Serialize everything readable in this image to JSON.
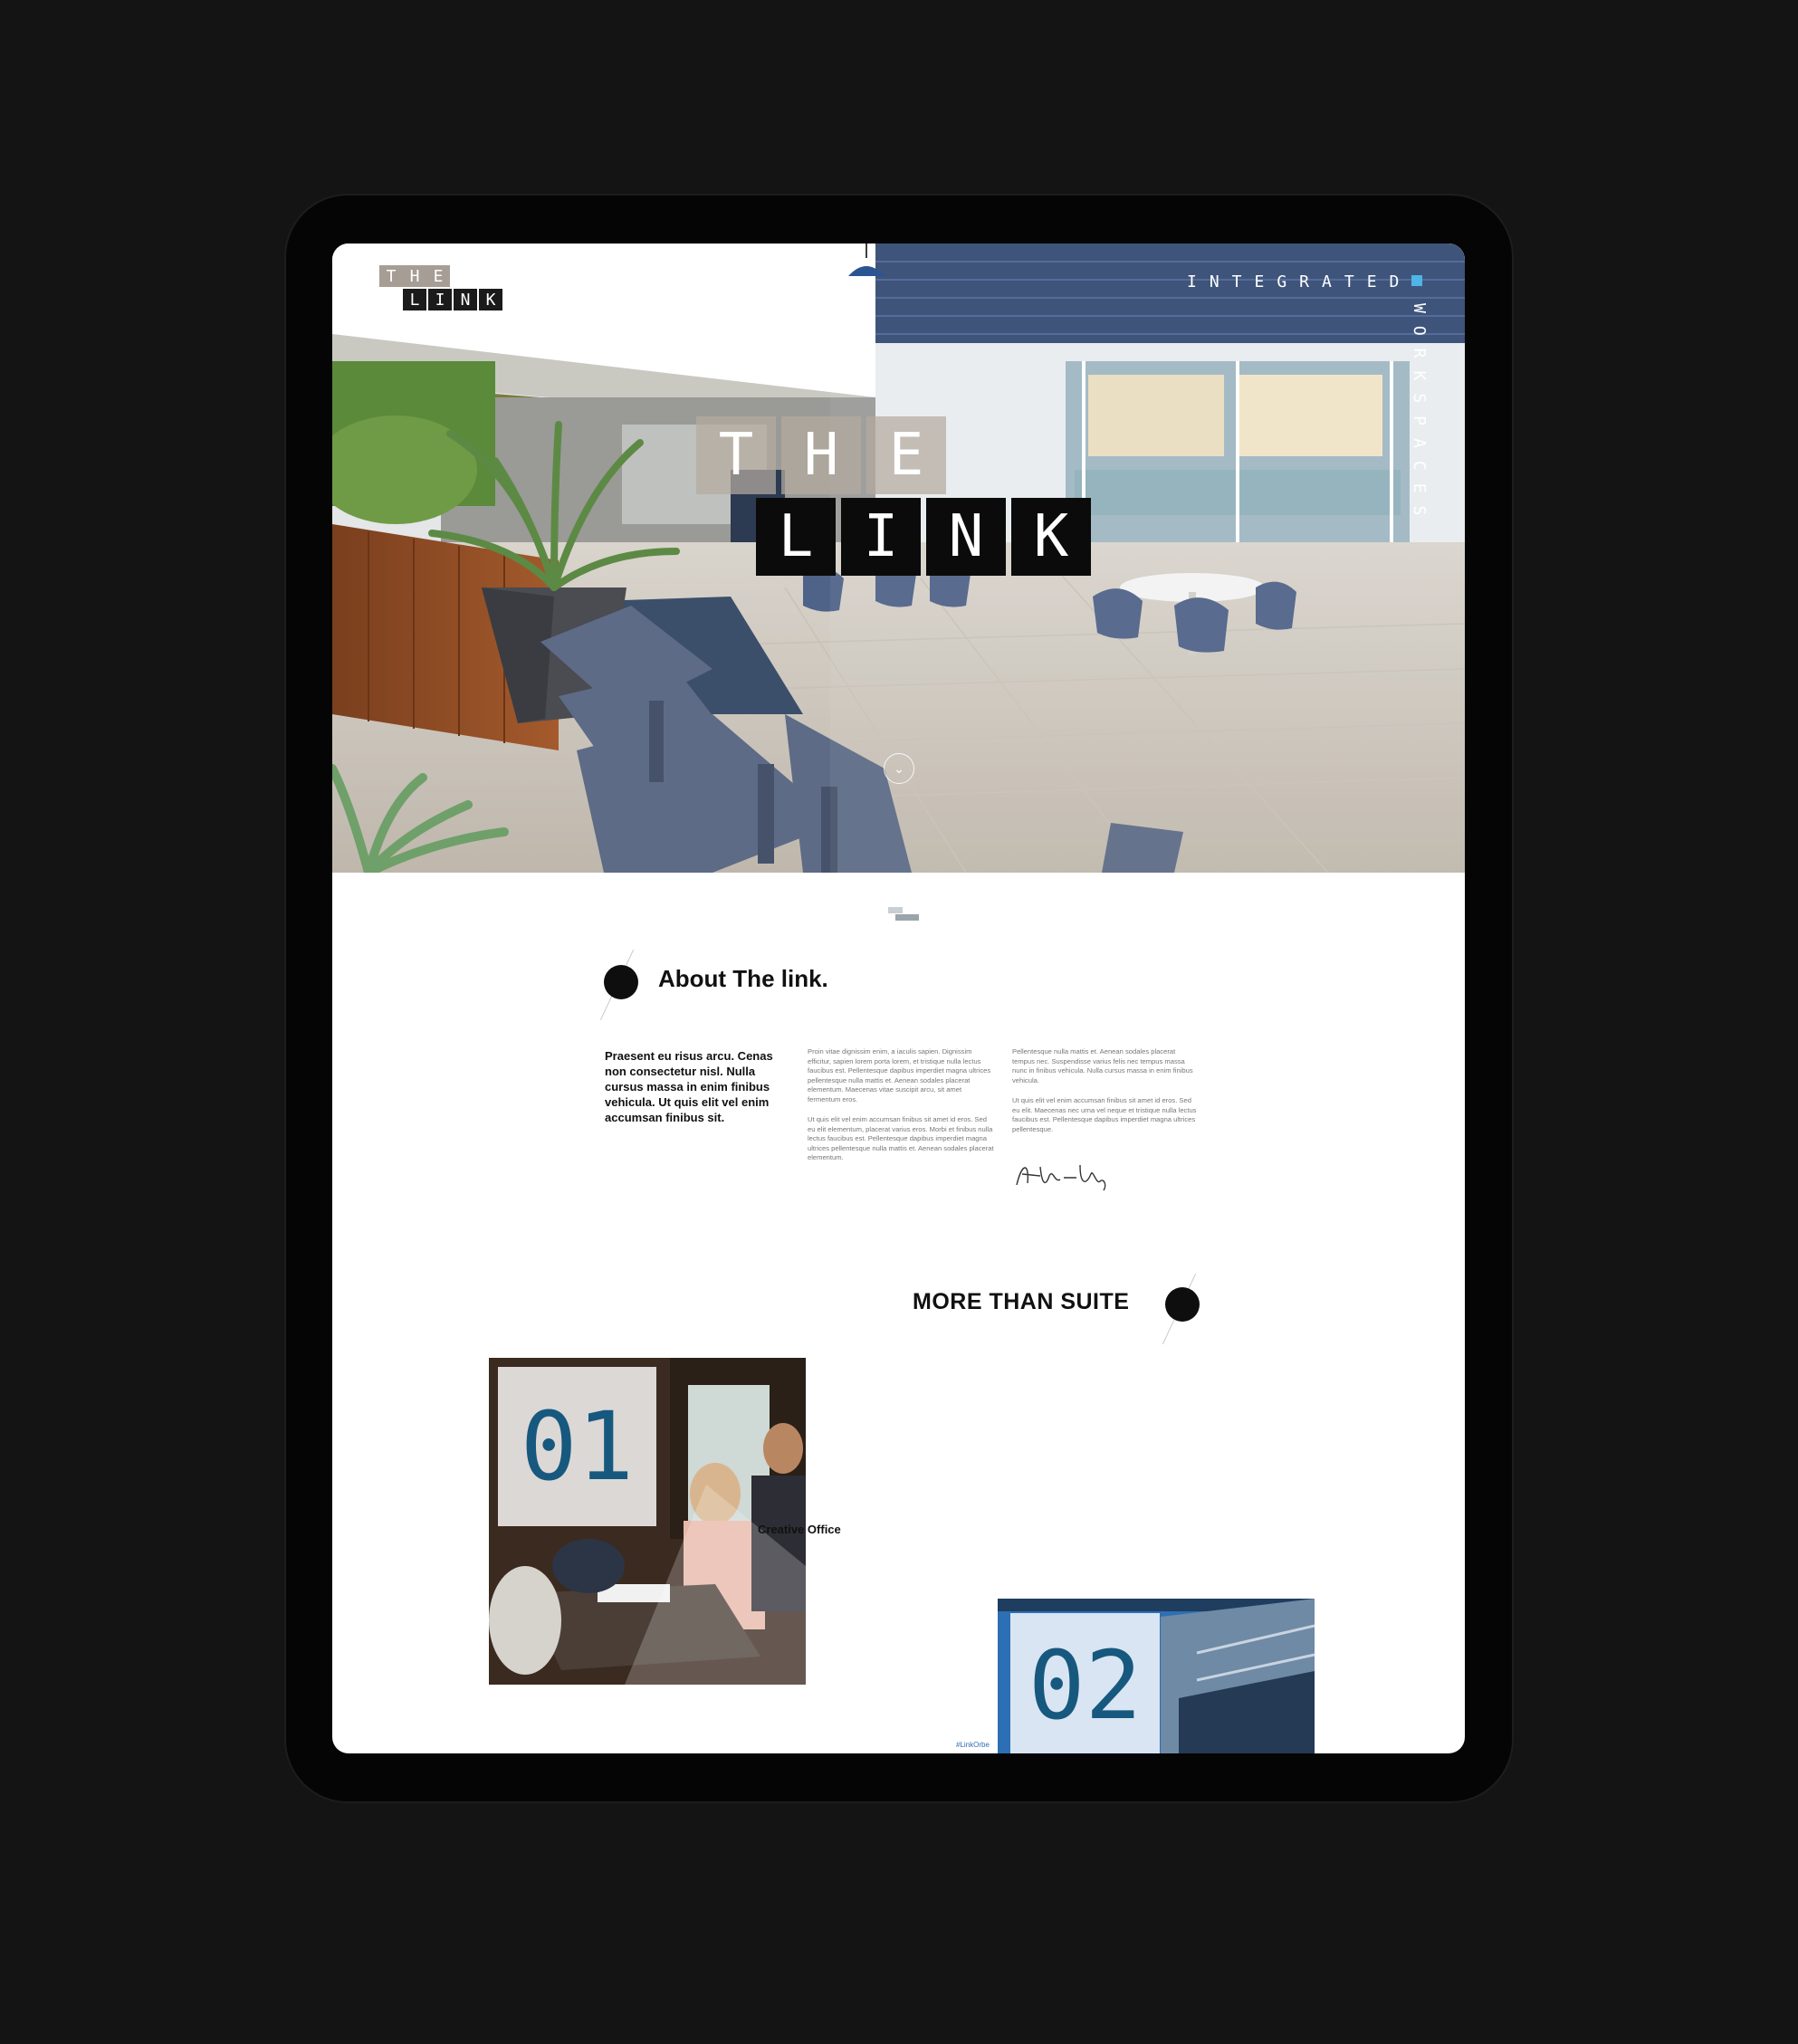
{
  "hero": {
    "logo_small": {
      "row1": [
        "T",
        "H",
        "E"
      ],
      "row2": [
        "L",
        "I",
        "N",
        "K"
      ]
    },
    "logo_big": {
      "row1": [
        "T",
        "H",
        "E"
      ],
      "row2": [
        "L",
        "I",
        "N",
        "K"
      ]
    },
    "tagline_horizontal": "INTEGRATED",
    "tagline_vertical": "WORKSPACES",
    "accent_color": "#4fb4e6"
  },
  "about": {
    "title": "About The link.",
    "lead": "Praesent eu risus arcu. Cenas non consectetur nisl. Nulla cursus massa in enim finibus vehicula. Ut quis elit vel enim accumsan finibus sit.",
    "col2": [
      "Proin vitae dignissim enim, a iaculis sapien. Dignissim efficitur, sapien lorem porta lorem, et tristique nulla lectus faucibus est. Pellentesque dapibus imperdiet magna ultrices pellentesque nulla mattis et. Aenean sodales placerat elementum. Maecenas vitae suscipit arcu, sit amet fermentum eros.",
      "Ut quis elit vel enim accumsan finibus sit amet id eros. Sed eu elit elementum, placerat varius eros. Morbi et finibus nulla lectus faucibus est. Pellentesque dapibus imperdiet magna ultrices pellentesque nulla mattis et. Aenean sodales placerat elementum."
    ],
    "col3": [
      "Pellentesque nulla mattis et. Aenean sodales placerat tempus nec. Suspendisse varius felis nec tempus massa nunc in finibus vehicula. Nulla cursus massa in enim finibus vehicula.",
      "Ut quis elit vel enim accumsan finibus sit amet id eros. Sed eu elit. Maecenas nec urna vel neque et tristique nulla lectus faucibus est. Pellentesque dapibus imperdiet magna ultrices pellentesque."
    ]
  },
  "suites": {
    "title": "MORE THAN SUITE",
    "cards": [
      {
        "number": "01",
        "label": "Creative Office"
      },
      {
        "number": "02",
        "caption": "#LinkOrbe"
      }
    ]
  }
}
